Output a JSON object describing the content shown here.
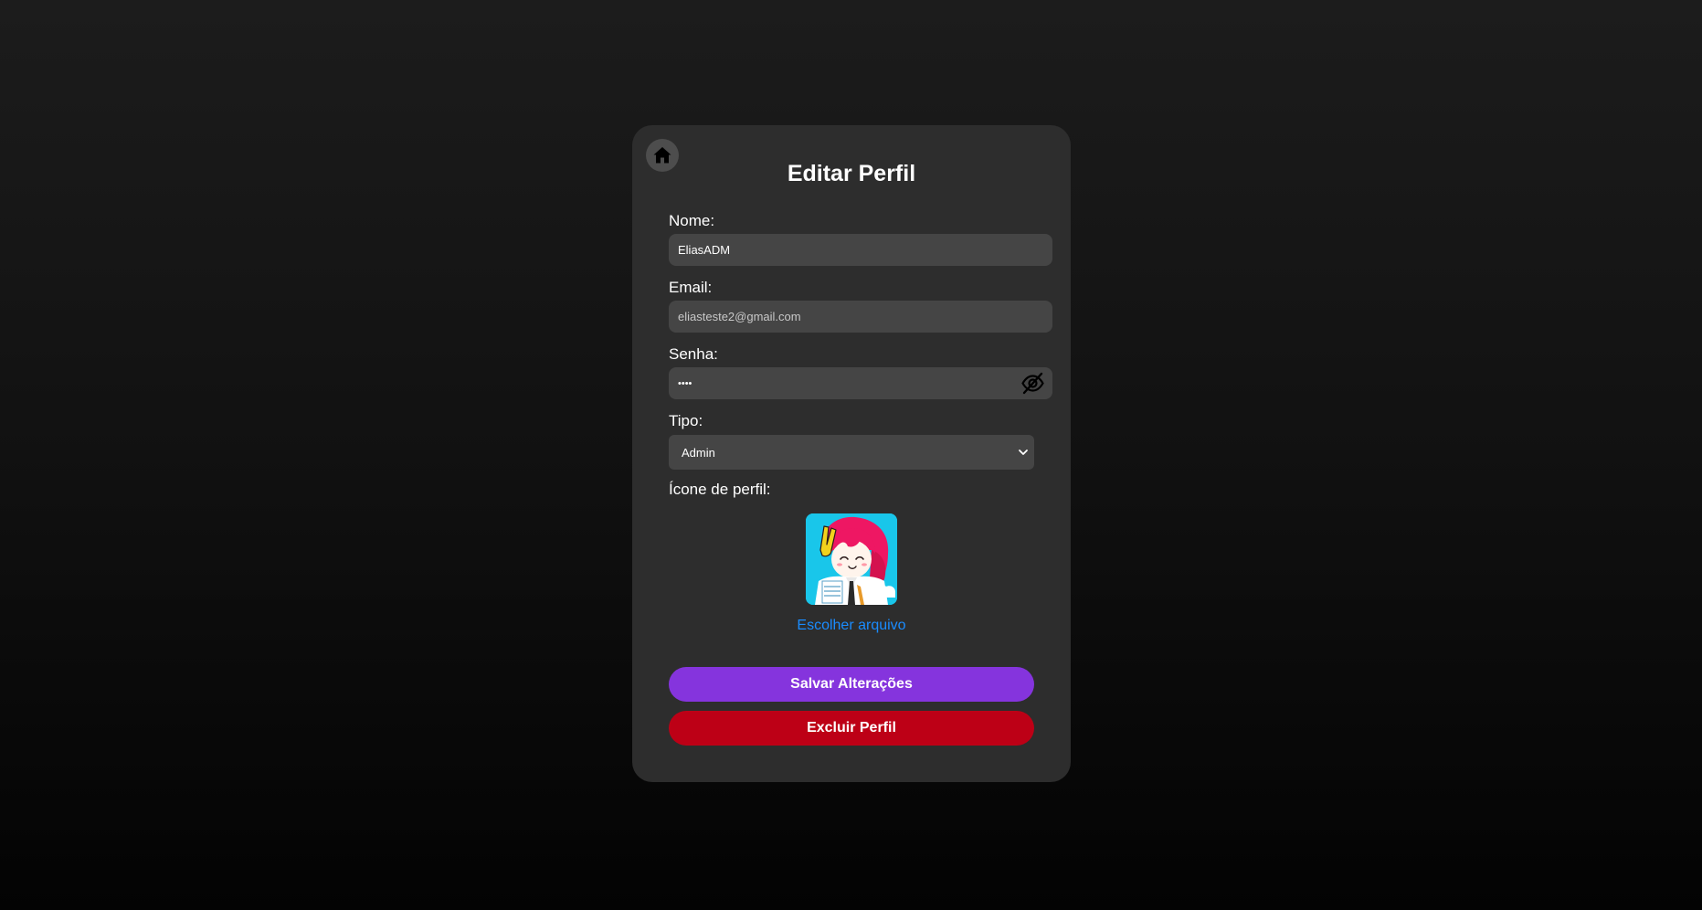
{
  "profile_form": {
    "title": "Editar Perfil",
    "home_icon": "home-icon",
    "name": {
      "label": "Nome:",
      "value": "EliasADM"
    },
    "email": {
      "label": "Email:",
      "value": "eliasteste2@gmail.com"
    },
    "password": {
      "label": "Senha:",
      "value": "••••",
      "toggle_icon": "eye-off-icon"
    },
    "type": {
      "label": "Tipo:",
      "selected": "Admin"
    },
    "icon": {
      "label": "Ícone de perfil:",
      "choose_file": "Escolher arquivo"
    },
    "save_button": "Salvar Alterações",
    "delete_button": "Excluir Perfil"
  },
  "colors": {
    "card_bg": "#2d2d2d",
    "field_bg": "#454545",
    "save": "#8534dd",
    "delete": "#bd0016",
    "link": "#1a8cff"
  }
}
